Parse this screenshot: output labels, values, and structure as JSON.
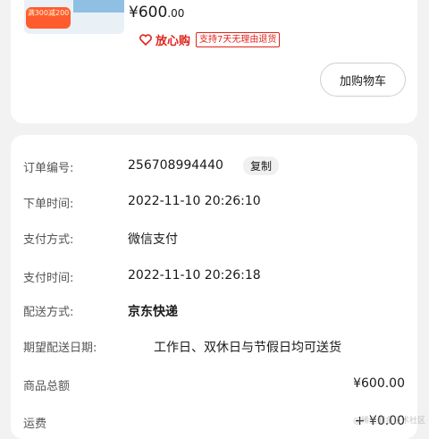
{
  "product": {
    "promo_text": "满300减200",
    "price_main": "¥600",
    "price_cents": ".00",
    "assurance_label": "放心购",
    "return_policy": "支持7天无理由退货",
    "add_to_cart_label": "加购物车"
  },
  "order": {
    "number": {
      "label": "订单编号:",
      "value": "256708994440",
      "copy_label": "复制"
    },
    "order_time": {
      "label": "下单时间:",
      "value": "2022-11-10 20:26:10"
    },
    "payment_method": {
      "label": "支付方式:",
      "value": "微信支付"
    },
    "payment_time": {
      "label": "支付时间:",
      "value": "2022-11-10 20:26:18"
    },
    "delivery_method": {
      "label": "配送方式:",
      "value": "京东快递"
    },
    "delivery_date": {
      "label": "期望配送日期:",
      "value": "工作日、双休日与节假日均可送货"
    },
    "total": {
      "label": "商品总额",
      "value": "¥600.00"
    },
    "shipping": {
      "label": "运费",
      "value": "+ ¥0.00"
    }
  },
  "colors": {
    "accent": "#e2231a",
    "background": "#f2f2f2"
  },
  "watermark": "@稀土掘金技术社区"
}
